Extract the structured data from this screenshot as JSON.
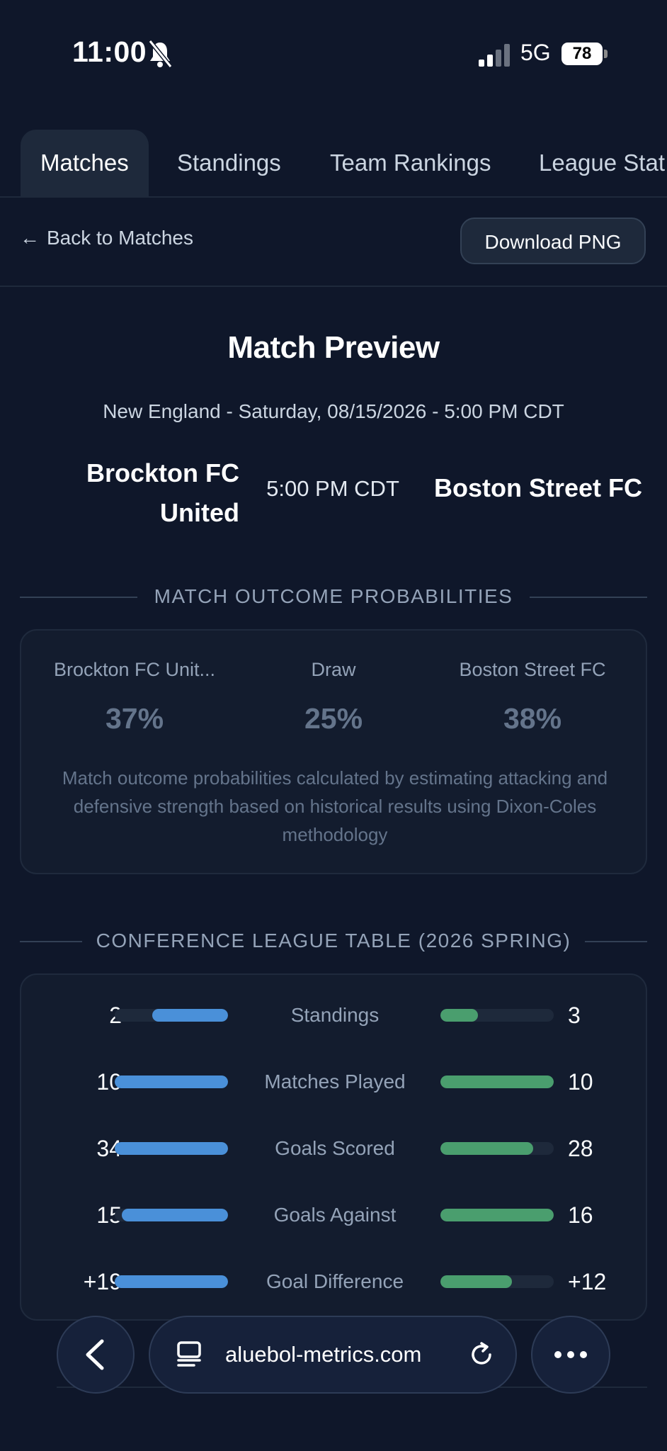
{
  "status_bar": {
    "time": "11:00",
    "network": "5G",
    "battery": "78"
  },
  "tabs": [
    {
      "label": "Matches",
      "active": true
    },
    {
      "label": "Standings",
      "active": false
    },
    {
      "label": "Team Rankings",
      "active": false
    },
    {
      "label": "League Stat",
      "active": false
    }
  ],
  "toolbar": {
    "back_label": "Back to Matches",
    "download_label": "Download PNG"
  },
  "match": {
    "title": "Match Preview",
    "subtitle": "New England - Saturday, 08/15/2026 - 5:00 PM CDT",
    "home_team": "Brockton FC United",
    "kickoff": "5:00 PM CDT",
    "away_team": "Boston Street FC"
  },
  "probabilities": {
    "heading": "MATCH OUTCOME PROBABILITIES",
    "home_label": "Brockton FC Unit...",
    "home_value": "37%",
    "draw_label": "Draw",
    "draw_value": "25%",
    "away_label": "Boston Street FC",
    "away_value": "38%",
    "note": "Match outcome probabilities calculated by estimating attacking and defensive strength based on historical results using Dixon-Coles methodology"
  },
  "league_table": {
    "heading": "CONFERENCE LEAGUE TABLE (2026 SPRING)",
    "rows": [
      {
        "label": "Standings",
        "home": "2",
        "away": "3",
        "home_fill": 0.67,
        "away_fill": 0.33
      },
      {
        "label": "Matches Played",
        "home": "10",
        "away": "10",
        "home_fill": 1.0,
        "away_fill": 1.0
      },
      {
        "label": "Goals Scored",
        "home": "34",
        "away": "28",
        "home_fill": 1.0,
        "away_fill": 0.82
      },
      {
        "label": "Goals Against",
        "home": "15",
        "away": "16",
        "home_fill": 0.94,
        "away_fill": 1.0
      },
      {
        "label": "Goal Difference",
        "home": "+19",
        "away": "+12",
        "home_fill": 1.0,
        "away_fill": 0.63
      }
    ]
  },
  "browser": {
    "url": "aluebol-metrics.com"
  },
  "colors": {
    "background": "#0f172a",
    "home_bar": "#4a90d9",
    "away_bar": "#4a9e6e"
  }
}
